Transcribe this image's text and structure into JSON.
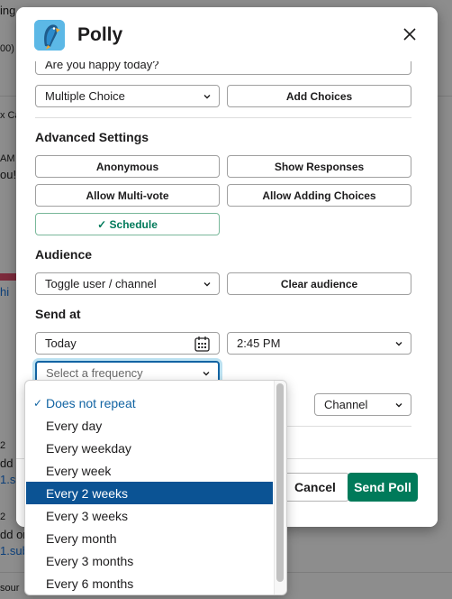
{
  "background": {
    "fragments": [
      "ing",
      "00)",
      "x Ca",
      "AM",
      "ou!",
      "hi",
      "2",
      "dd",
      "1.s",
      "2",
      "dd or",
      "1.sub",
      "sour"
    ]
  },
  "modal": {
    "title": "Polly",
    "question_value": "Are you happy today?",
    "poll_type": "Multiple Choice",
    "add_choices_label": "Add Choices",
    "advanced_settings_label": "Advanced Settings",
    "anonymous_label": "Anonymous",
    "show_responses_label": "Show Responses",
    "allow_multivote_label": "Allow Multi-vote",
    "allow_adding_choices_label": "Allow Adding Choices",
    "schedule_label": "✓ Schedule",
    "audience_label": "Audience",
    "audience_placeholder": "Toggle user / channel",
    "clear_audience_label": "Clear audience",
    "send_at_label": "Send at",
    "date_value": "Today",
    "time_value": "2:45 PM",
    "frequency_placeholder": "Select a frequency",
    "channel_value": "Channel",
    "cancel_label": "Cancel",
    "send_label": "Send Poll"
  },
  "frequency_menu": {
    "items": [
      {
        "label": "Does not repeat",
        "checked": true
      },
      {
        "label": "Every day"
      },
      {
        "label": "Every weekday"
      },
      {
        "label": "Every week"
      },
      {
        "label": "Every 2 weeks",
        "highlighted": true
      },
      {
        "label": "Every 3 weeks"
      },
      {
        "label": "Every month"
      },
      {
        "label": "Every 3 months"
      },
      {
        "label": "Every 6 months"
      }
    ]
  },
  "colors": {
    "primary": "#007a5a",
    "highlight": "#0b5394",
    "link": "#1264a3"
  },
  "icons": [
    "parrot-logo-icon",
    "close-icon",
    "chevron-down-icon",
    "calendar-icon",
    "check-icon"
  ]
}
